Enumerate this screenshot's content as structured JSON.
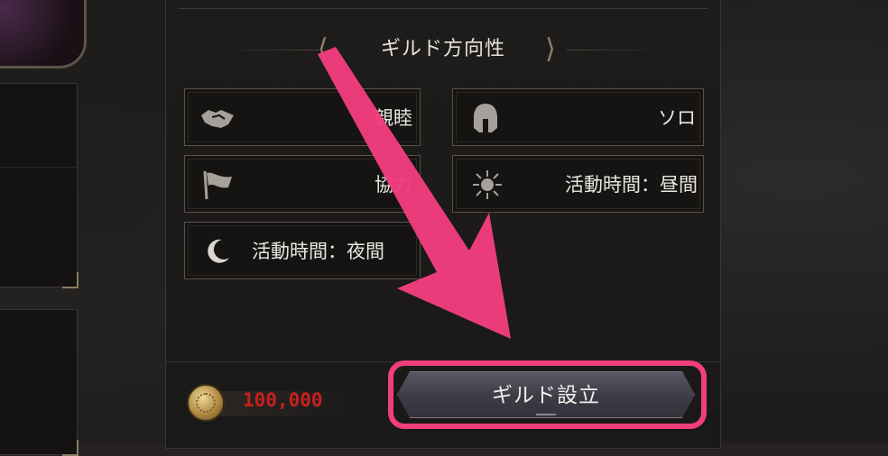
{
  "section": {
    "title": "ギルド方向性"
  },
  "tags": [
    {
      "label": "親睦",
      "icon": "handshake-icon"
    },
    {
      "label": "ソロ",
      "icon": "helmet-icon"
    },
    {
      "label": "協力",
      "icon": "flag-icon"
    },
    {
      "label": "活動時間：昼間",
      "icon": "sun-icon"
    },
    {
      "label": "活動時間：夜間",
      "icon": "moon-icon"
    }
  ],
  "footer": {
    "cost_amount": "100,000",
    "cost_icon": "gold-coin-icon",
    "primary_button": "ギルド設立"
  },
  "colors": {
    "highlight": "#f23d7e",
    "cost_text": "#c8201c",
    "button_bg": "#3e3b46"
  }
}
